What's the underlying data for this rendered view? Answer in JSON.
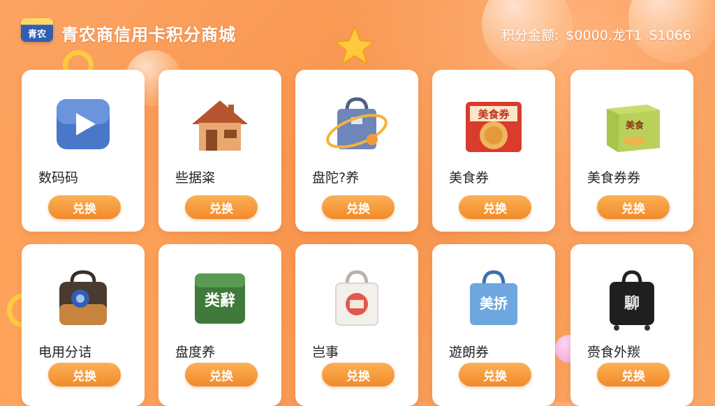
{
  "header": {
    "logo_text": "青农",
    "title": "青农商信用卡积分商城",
    "points_label": "积分金额:",
    "points_value": "$0000.龙T1",
    "points_extra": "S1066"
  },
  "products": [
    {
      "name": "数码码",
      "button": "兑换",
      "icon": "video-play-icon"
    },
    {
      "name": "些据粢",
      "button": "兑换",
      "icon": "house-icon"
    },
    {
      "name": "盘陀?养",
      "button": "兑换",
      "icon": "shopping-bag-icon"
    },
    {
      "name": "美食券",
      "button": "兑换",
      "icon": "food-voucher-box-icon",
      "icon_text": "美食券"
    },
    {
      "name": "美食券券",
      "button": "兑换",
      "icon": "gift-box-icon",
      "icon_text": "美食"
    },
    {
      "name": "电用分诘",
      "button": "兑换",
      "icon": "travel-bag-icon"
    },
    {
      "name": "盘度养",
      "button": "兑换",
      "icon": "green-card-icon",
      "icon_text": "类辭"
    },
    {
      "name": "岂事",
      "button": "兑换",
      "icon": "white-tote-bag-icon"
    },
    {
      "name": "遊朗券",
      "button": "兑换",
      "icon": "blue-bag-icon",
      "icon_text": "美挢"
    },
    {
      "name": "赍食外羰",
      "button": "兑换",
      "icon": "black-suitcase-icon",
      "icon_text": "駠"
    }
  ]
}
